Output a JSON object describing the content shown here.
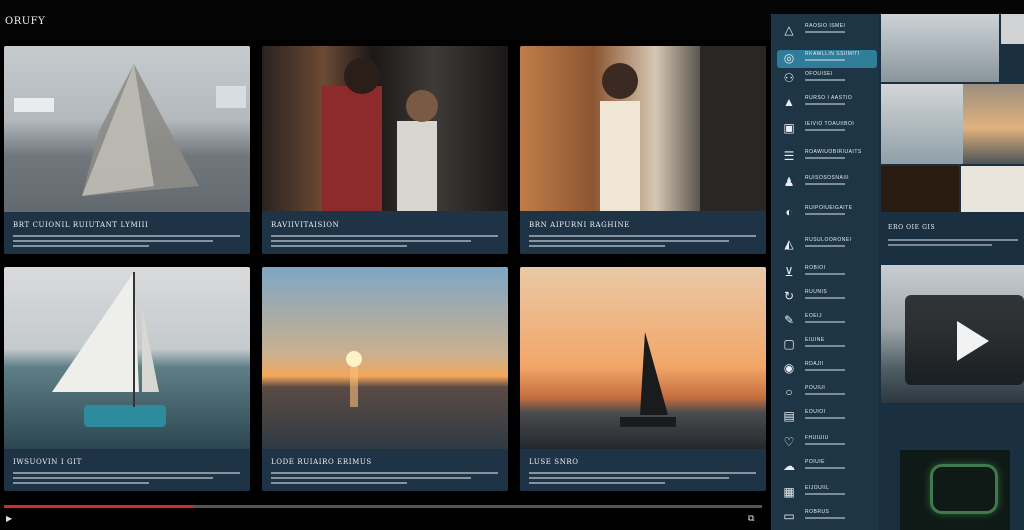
{
  "app": {
    "title": "ORUFY"
  },
  "cards": [
    {
      "title": "BRT CUIONIL RUIUTANT LYMIII",
      "scene": "sea-grey"
    },
    {
      "title": "RAVIIVITAISION",
      "scene": "doorway"
    },
    {
      "title": "BRN AIPURNI RAGHINE",
      "scene": "hallway"
    },
    {
      "title": "IWSUOVIN I GIT",
      "scene": "sail-day"
    },
    {
      "title": "LODE RUIAIRO ERIMUS",
      "scene": "sunset"
    },
    {
      "title": "LUSE SNRO",
      "scene": "sunset2"
    }
  ],
  "player": {
    "progress": 0.25,
    "play_label": "▶",
    "cc_label": "⧉"
  },
  "sidebar": {
    "items": [
      {
        "icon": "triangle-icon",
        "glyph": "△",
        "label": "RAOSIO ISMEI"
      },
      {
        "icon": "globe-icon",
        "glyph": "◎",
        "label": "RKAWLLIN SSIIMITI"
      },
      {
        "icon": "person-icon",
        "glyph": "⚇",
        "label": "OFOUISEI"
      },
      {
        "icon": "triangle-icon",
        "glyph": "▲",
        "label": "RURSO I AASTIO"
      },
      {
        "icon": "box-icon",
        "glyph": "▣",
        "label": "IEIVIO TOAUIIBOI"
      },
      {
        "icon": "stack-icon",
        "glyph": "☰",
        "label": "ROAWIUOBIRIUAITS"
      },
      {
        "icon": "group-icon",
        "glyph": "♟",
        "label": "RUISOSOSNAIII"
      },
      {
        "icon": "circle-icon",
        "glyph": "◐",
        "label": "RUIPOIUEIGAITE"
      },
      {
        "icon": "triangle-icon",
        "glyph": "◭",
        "label": "RUSULOORONEI"
      },
      {
        "icon": "cup-icon",
        "glyph": "⊻",
        "label": "ROBIOI"
      },
      {
        "icon": "refresh-icon",
        "glyph": "↻",
        "label": "RUUNIS"
      },
      {
        "icon": "pen-icon",
        "glyph": "✎",
        "label": "EOEIJ"
      },
      {
        "icon": "square-icon",
        "glyph": "▢",
        "label": "EIUINE"
      },
      {
        "icon": "target-icon",
        "glyph": "◉",
        "label": "RDAJII"
      },
      {
        "icon": "ring-icon",
        "glyph": "○",
        "label": "POUIUI"
      },
      {
        "icon": "chart-icon",
        "glyph": "▤",
        "label": "EOUIOI"
      },
      {
        "icon": "heart-icon",
        "glyph": "♡",
        "label": "FHUIUIU"
      },
      {
        "icon": "cloud-icon",
        "glyph": "☁",
        "label": "POIUIE"
      },
      {
        "icon": "grid-icon",
        "glyph": "▦",
        "label": "EIJOUIIL"
      },
      {
        "icon": "screen-icon",
        "glyph": "▭",
        "label": "ROBRUS"
      }
    ]
  },
  "right_panel": {
    "caption": "ERO OIE GIS",
    "video_label": "Play"
  }
}
